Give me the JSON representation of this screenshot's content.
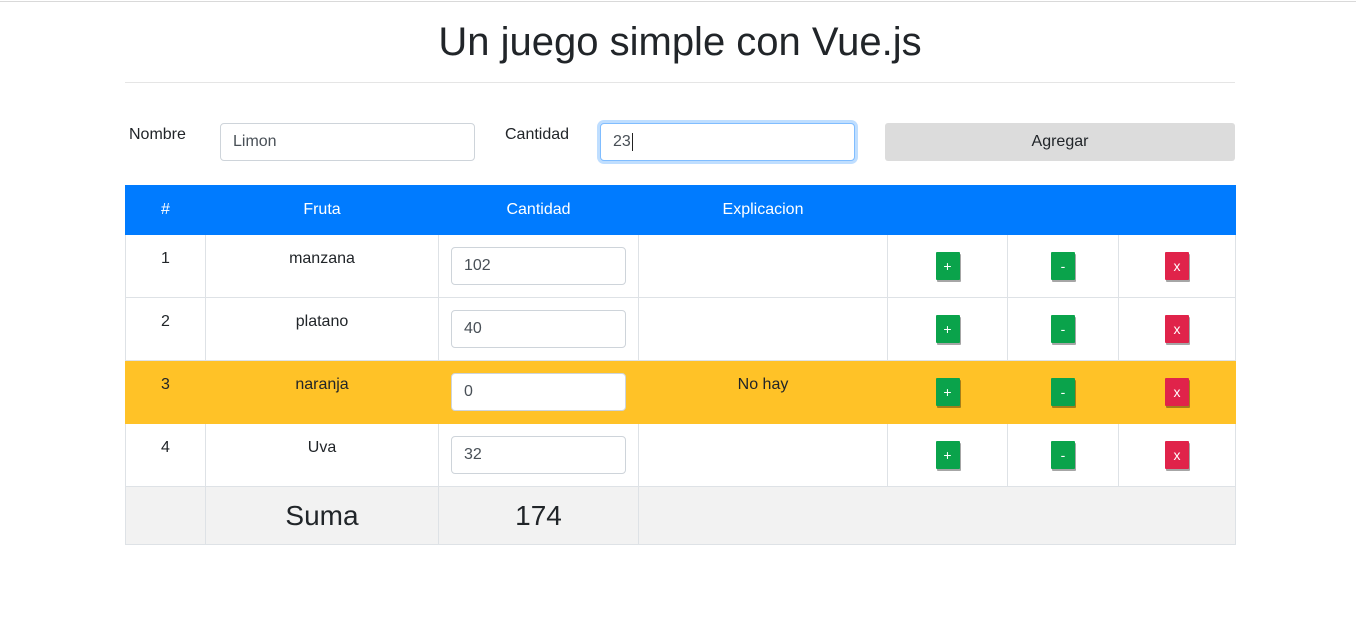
{
  "title": "Un juego simple con Vue.js",
  "form": {
    "nombre_label": "Nombre",
    "nombre_value": "Limon",
    "cantidad_label": "Cantidad",
    "cantidad_value": "23",
    "agregar_label": "Agregar"
  },
  "table": {
    "headers": [
      "#",
      "Fruta",
      "Cantidad",
      "Explicacion",
      "",
      "",
      ""
    ],
    "rows": [
      {
        "n": "1",
        "fruta": "manzana",
        "cantidad": "102",
        "explicacion": ""
      },
      {
        "n": "2",
        "fruta": "platano",
        "cantidad": "40",
        "explicacion": ""
      },
      {
        "n": "3",
        "fruta": "naranja",
        "cantidad": "0",
        "explicacion": "No hay"
      },
      {
        "n": "4",
        "fruta": "Uva",
        "cantidad": "32",
        "explicacion": ""
      }
    ],
    "buttons": {
      "plus": "+",
      "minus": "-",
      "remove": "x"
    },
    "footer": {
      "label": "Suma",
      "total": "174"
    }
  },
  "colors": {
    "header": "#007bff",
    "warning_row": "#ffc227",
    "add_button": "#0aa34b",
    "remove_button": "#e0234a",
    "agregar_button": "#dcdcdc"
  }
}
